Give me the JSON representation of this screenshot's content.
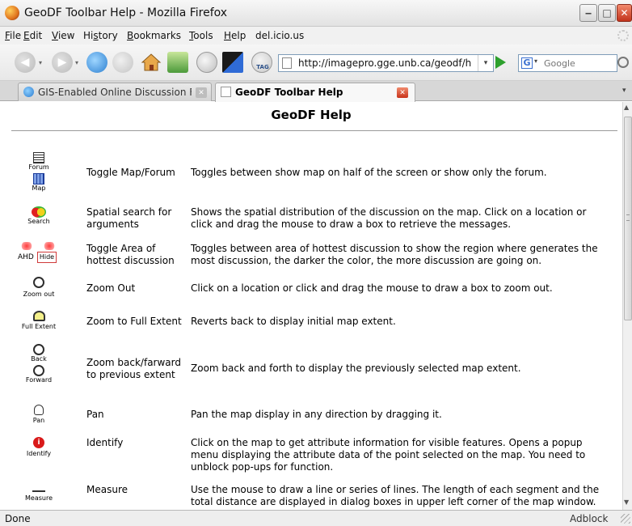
{
  "window": {
    "title": "GeoDF Toolbar Help - Mozilla Firefox",
    "min_glyph": "‒",
    "max_glyph": "□",
    "close_glyph": "✕"
  },
  "menu": [
    {
      "accel": "F",
      "rest": "ile"
    },
    {
      "accel": "E",
      "rest": "dit"
    },
    {
      "accel": "V",
      "rest": "iew"
    },
    {
      "pre": "Hi",
      "accel": "s",
      "rest": "tory"
    },
    {
      "accel": "B",
      "rest": "ookmarks"
    },
    {
      "accel": "T",
      "rest": "ools"
    },
    {
      "accel": "H",
      "rest": "elp"
    },
    {
      "label": "del.icio.us"
    }
  ],
  "navbar": {
    "back_glyph": "◀",
    "forward_glyph": "▶",
    "drop_glyph": "▾",
    "tag_label": "TAG",
    "url": "http://imagepro.gge.unb.ca/geodf/help",
    "url_drop_glyph": "▾",
    "search_engine_letter": "G",
    "search_placeholder": "Google"
  },
  "tabs": [
    {
      "label": "GIS-Enabled Online Discussion For...",
      "close_glyph": "✕",
      "active": false
    },
    {
      "label": "GeoDF Toolbar Help",
      "close_glyph": "✕",
      "active": true
    }
  ],
  "tabs_menu_glyph": "▾",
  "page": {
    "title": "GeoDF Help",
    "rows": [
      {
        "labels": [
          "Forum",
          "Map"
        ],
        "name": "Toggle Map/Forum",
        "desc": "Toggles between show map on half of the screen or show only the forum."
      },
      {
        "labels": [
          "Search"
        ],
        "name": "Spatial search for arguments",
        "desc": "Shows the spatial distribution of the discussion on the map. Click on a location or click and drag the mouse to draw a box to retrieve the messages."
      },
      {
        "labels": [
          "AHD",
          "Hide"
        ],
        "name": "Toggle Area of hottest discussion",
        "desc": "Toggles between area of hottest discussion to show the region where generates the most discussion, the darker the color, the more discussion are going on."
      },
      {
        "labels": [
          "Zoom out"
        ],
        "name": "Zoom Out",
        "desc": "Click on a location or click and drag the mouse to draw a box to zoom out."
      },
      {
        "labels": [
          "Full Extent"
        ],
        "name": "Zoom to Full Extent",
        "desc": "Reverts back to display initial map extent."
      },
      {
        "labels": [
          "Back",
          "Forward"
        ],
        "name": "Zoom back/farward to previous extent",
        "desc": "Zoom back and forth to display the previously selected map extent."
      },
      {
        "labels": [
          "Pan"
        ],
        "name": "Pan",
        "desc": "Pan the map display in any direction by dragging it."
      },
      {
        "labels": [
          "Identify"
        ],
        "icon_glyph": "i",
        "name": "Identify",
        "desc": "Click on the map to get attribute information for visible features. Opens a popup menu displaying the attribute data of the point selected on the map. You need to unblock pop-ups for function."
      },
      {
        "labels": [
          "Measure"
        ],
        "name": "Measure",
        "desc": "Use the mouse to draw a line or series of lines. The length of each segment and the total distance are displayed in dialog boxes in upper left corner of the map window."
      }
    ]
  },
  "scrollbar": {
    "up_glyph": "▲",
    "down_glyph": "▼"
  },
  "status": {
    "text": "Done",
    "addon": "Adblock"
  },
  "colors": {
    "accent_close": "#c8331b",
    "link_blue": "#2a7bcf",
    "go_green": "#2da02d"
  }
}
